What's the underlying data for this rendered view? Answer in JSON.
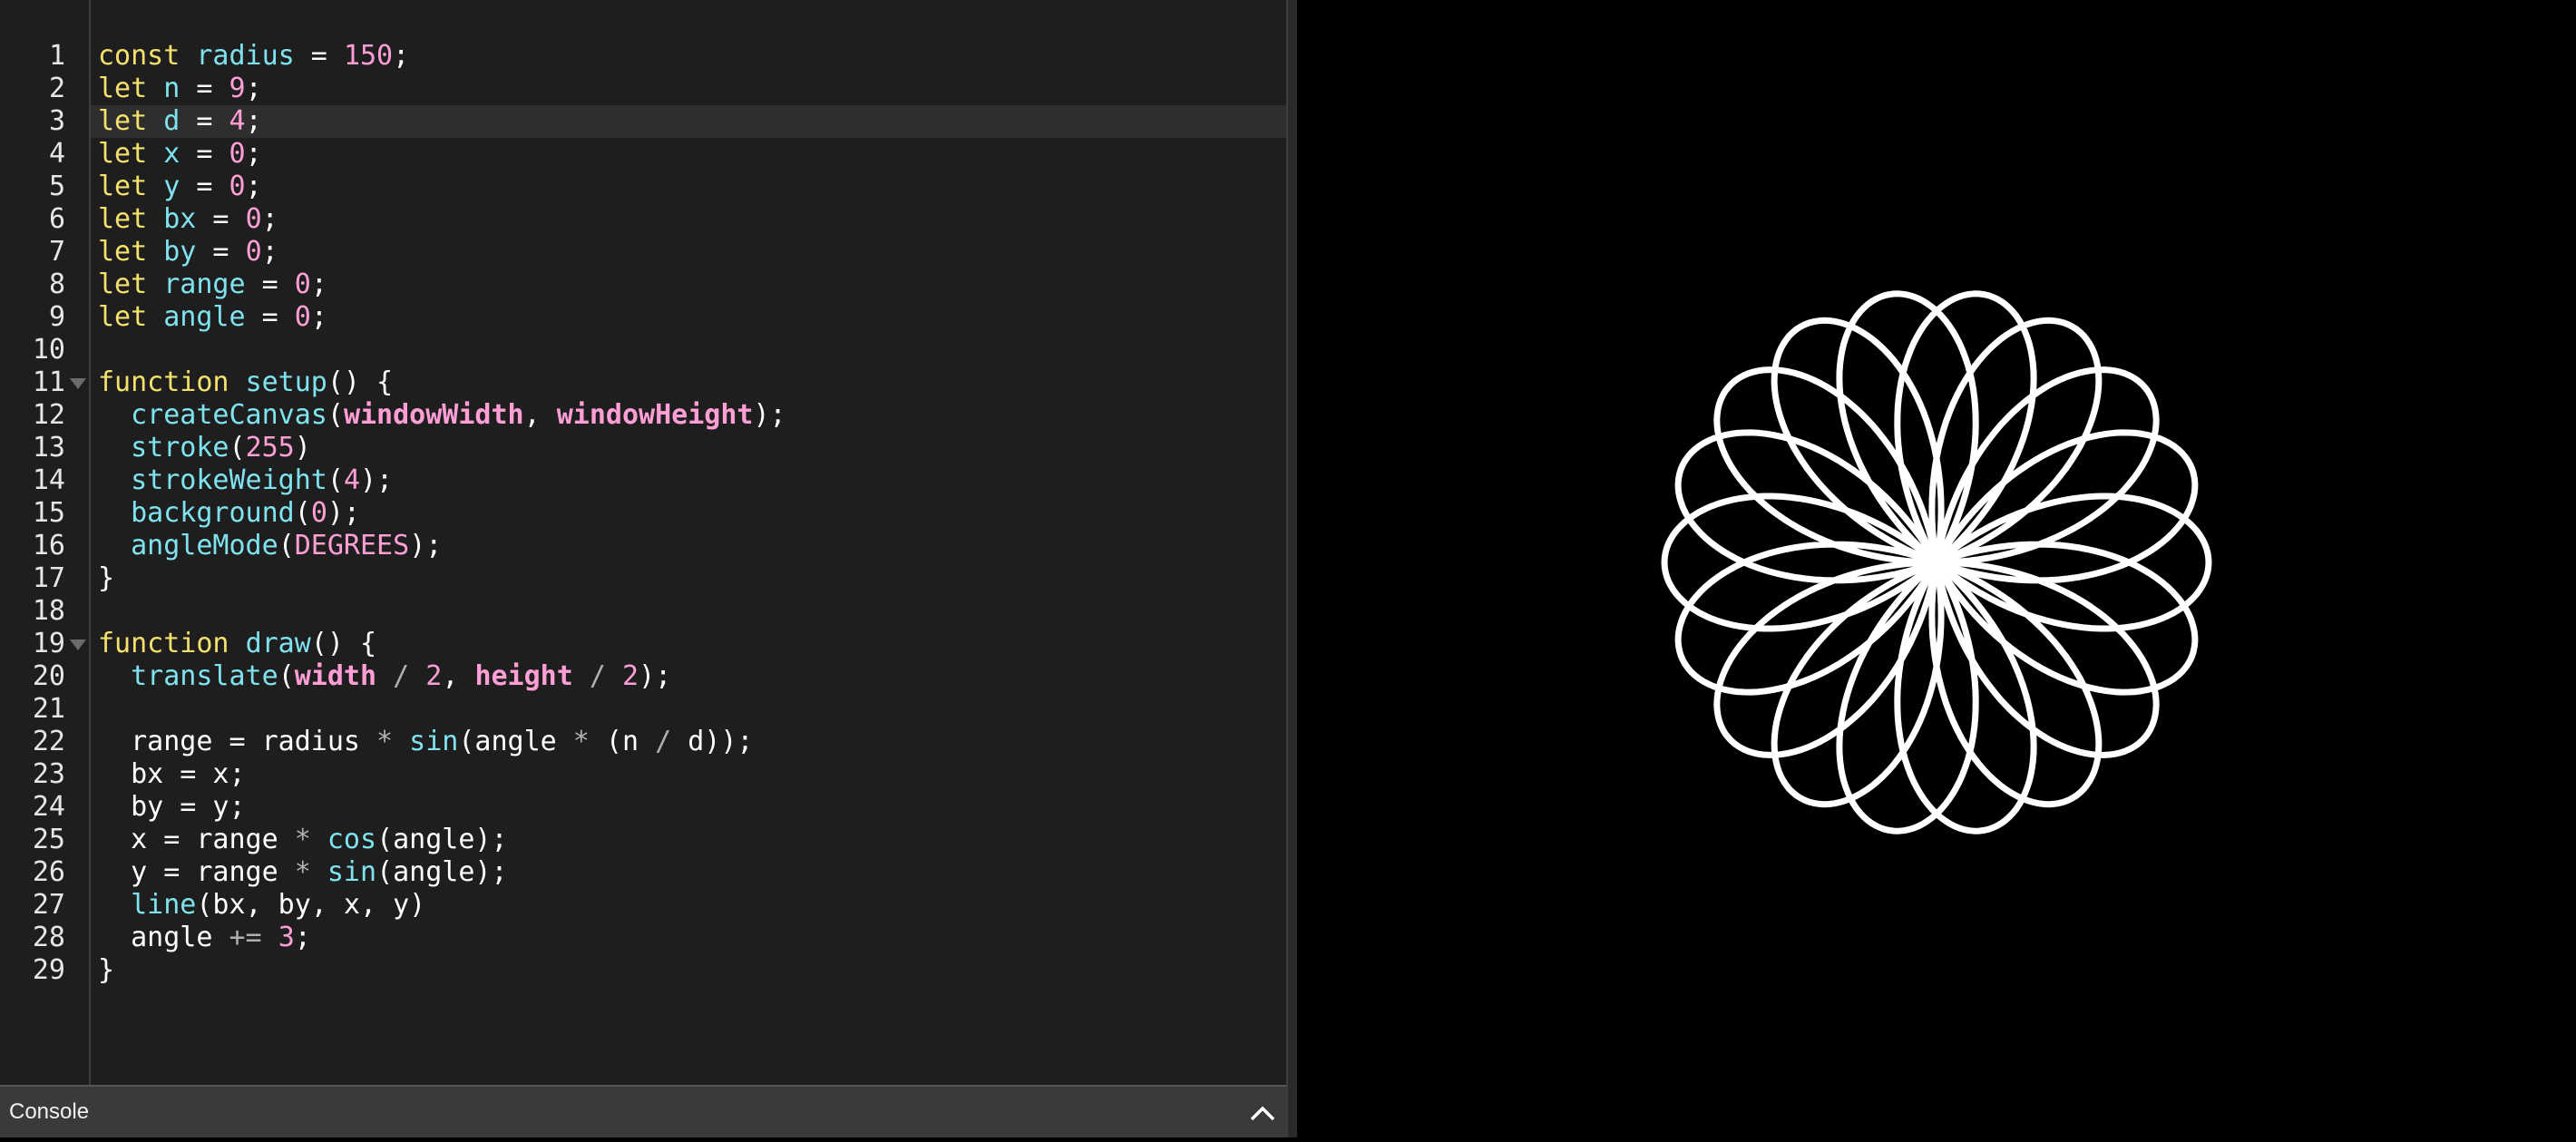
{
  "editor": {
    "current_line": 3,
    "line_numbers": [
      "1",
      "2",
      "3",
      "4",
      "5",
      "6",
      "7",
      "8",
      "9",
      "10",
      "11",
      "12",
      "13",
      "14",
      "15",
      "16",
      "17",
      "18",
      "19",
      "20",
      "21",
      "22",
      "23",
      "24",
      "25",
      "26",
      "27",
      "28",
      "29"
    ],
    "fold_lines": [
      11,
      19
    ],
    "lines": [
      [
        [
          "kw",
          "const"
        ],
        [
          "t",
          " "
        ],
        [
          "vr",
          "radius"
        ],
        [
          "t",
          " = "
        ],
        [
          "nm",
          "150"
        ],
        [
          "t",
          ";"
        ]
      ],
      [
        [
          "kw",
          "let"
        ],
        [
          "t",
          " "
        ],
        [
          "vr",
          "n"
        ],
        [
          "t",
          " = "
        ],
        [
          "nm",
          "9"
        ],
        [
          "t",
          ";"
        ]
      ],
      [
        [
          "kw",
          "let"
        ],
        [
          "t",
          " "
        ],
        [
          "vr",
          "d"
        ],
        [
          "t",
          " = "
        ],
        [
          "nm",
          "4"
        ],
        [
          "t",
          ";"
        ]
      ],
      [
        [
          "kw",
          "let"
        ],
        [
          "t",
          " "
        ],
        [
          "vr",
          "x"
        ],
        [
          "t",
          " = "
        ],
        [
          "nm",
          "0"
        ],
        [
          "t",
          ";"
        ]
      ],
      [
        [
          "kw",
          "let"
        ],
        [
          "t",
          " "
        ],
        [
          "vr",
          "y"
        ],
        [
          "t",
          " = "
        ],
        [
          "nm",
          "0"
        ],
        [
          "t",
          ";"
        ]
      ],
      [
        [
          "kw",
          "let"
        ],
        [
          "t",
          " "
        ],
        [
          "vr",
          "bx"
        ],
        [
          "t",
          " = "
        ],
        [
          "nm",
          "0"
        ],
        [
          "t",
          ";"
        ]
      ],
      [
        [
          "kw",
          "let"
        ],
        [
          "t",
          " "
        ],
        [
          "vr",
          "by"
        ],
        [
          "t",
          " = "
        ],
        [
          "nm",
          "0"
        ],
        [
          "t",
          ";"
        ]
      ],
      [
        [
          "kw",
          "let"
        ],
        [
          "t",
          " "
        ],
        [
          "vr",
          "range"
        ],
        [
          "t",
          " = "
        ],
        [
          "nm",
          "0"
        ],
        [
          "t",
          ";"
        ]
      ],
      [
        [
          "kw",
          "let"
        ],
        [
          "t",
          " "
        ],
        [
          "vr",
          "angle"
        ],
        [
          "t",
          " = "
        ],
        [
          "nm",
          "0"
        ],
        [
          "t",
          ";"
        ]
      ],
      [],
      [
        [
          "kw",
          "function"
        ],
        [
          "t",
          " "
        ],
        [
          "fn",
          "setup"
        ],
        [
          "t",
          "() {"
        ]
      ],
      [
        [
          "t",
          "  "
        ],
        [
          "fn",
          "createCanvas"
        ],
        [
          "t",
          "("
        ],
        [
          "bi",
          "windowWidth"
        ],
        [
          "t",
          ", "
        ],
        [
          "bi",
          "windowHeight"
        ],
        [
          "t",
          ");"
        ]
      ],
      [
        [
          "t",
          "  "
        ],
        [
          "fn",
          "stroke"
        ],
        [
          "t",
          "("
        ],
        [
          "nm",
          "255"
        ],
        [
          "t",
          ")"
        ]
      ],
      [
        [
          "t",
          "  "
        ],
        [
          "fn",
          "strokeWeight"
        ],
        [
          "t",
          "("
        ],
        [
          "nm",
          "4"
        ],
        [
          "t",
          ");"
        ]
      ],
      [
        [
          "t",
          "  "
        ],
        [
          "fn",
          "background"
        ],
        [
          "t",
          "("
        ],
        [
          "nm",
          "0"
        ],
        [
          "t",
          ");"
        ]
      ],
      [
        [
          "t",
          "  "
        ],
        [
          "fn",
          "angleMode"
        ],
        [
          "t",
          "("
        ],
        [
          "nm",
          "DEGREES"
        ],
        [
          "t",
          ");"
        ]
      ],
      [
        [
          "t",
          "}"
        ]
      ],
      [],
      [
        [
          "kw",
          "function"
        ],
        [
          "t",
          " "
        ],
        [
          "fn",
          "draw"
        ],
        [
          "t",
          "() {"
        ]
      ],
      [
        [
          "t",
          "  "
        ],
        [
          "fn",
          "translate"
        ],
        [
          "t",
          "("
        ],
        [
          "bi",
          "width"
        ],
        [
          "op",
          " / "
        ],
        [
          "nm",
          "2"
        ],
        [
          "t",
          ", "
        ],
        [
          "bi",
          "height"
        ],
        [
          "op",
          " / "
        ],
        [
          "nm",
          "2"
        ],
        [
          "t",
          ");"
        ]
      ],
      [],
      [
        [
          "t",
          "  range = radius "
        ],
        [
          "op",
          "*"
        ],
        [
          "t",
          " "
        ],
        [
          "fn",
          "sin"
        ],
        [
          "t",
          "(angle "
        ],
        [
          "op",
          "*"
        ],
        [
          "t",
          " (n "
        ],
        [
          "op",
          "/"
        ],
        [
          "t",
          " d));"
        ]
      ],
      [
        [
          "t",
          "  bx = x;"
        ]
      ],
      [
        [
          "t",
          "  by = y;"
        ]
      ],
      [
        [
          "t",
          "  x = range "
        ],
        [
          "op",
          "*"
        ],
        [
          "t",
          " "
        ],
        [
          "fn",
          "cos"
        ],
        [
          "t",
          "(angle);"
        ]
      ],
      [
        [
          "t",
          "  y = range "
        ],
        [
          "op",
          "*"
        ],
        [
          "t",
          " "
        ],
        [
          "fn",
          "sin"
        ],
        [
          "t",
          "(angle);"
        ]
      ],
      [
        [
          "t",
          "  "
        ],
        [
          "fn",
          "line"
        ],
        [
          "t",
          "(bx, by, x, y)"
        ]
      ],
      [
        [
          "t",
          "  angle "
        ],
        [
          "op",
          "+="
        ],
        [
          "t",
          " "
        ],
        [
          "nm",
          "3"
        ],
        [
          "t",
          ";"
        ]
      ],
      [
        [
          "t",
          "}"
        ]
      ]
    ]
  },
  "console": {
    "title": "Console",
    "toggle_icon": "chevron-up-icon"
  },
  "sketch": {
    "radius": 150,
    "n": 9,
    "d": 4,
    "stroke_color": "#ffffff",
    "background": "#000000"
  },
  "colors": {
    "keyword": "#f4e06c",
    "variable": "#7fe3ef",
    "number": "#ff9fd6",
    "editor_bg": "#1e1e1e"
  }
}
